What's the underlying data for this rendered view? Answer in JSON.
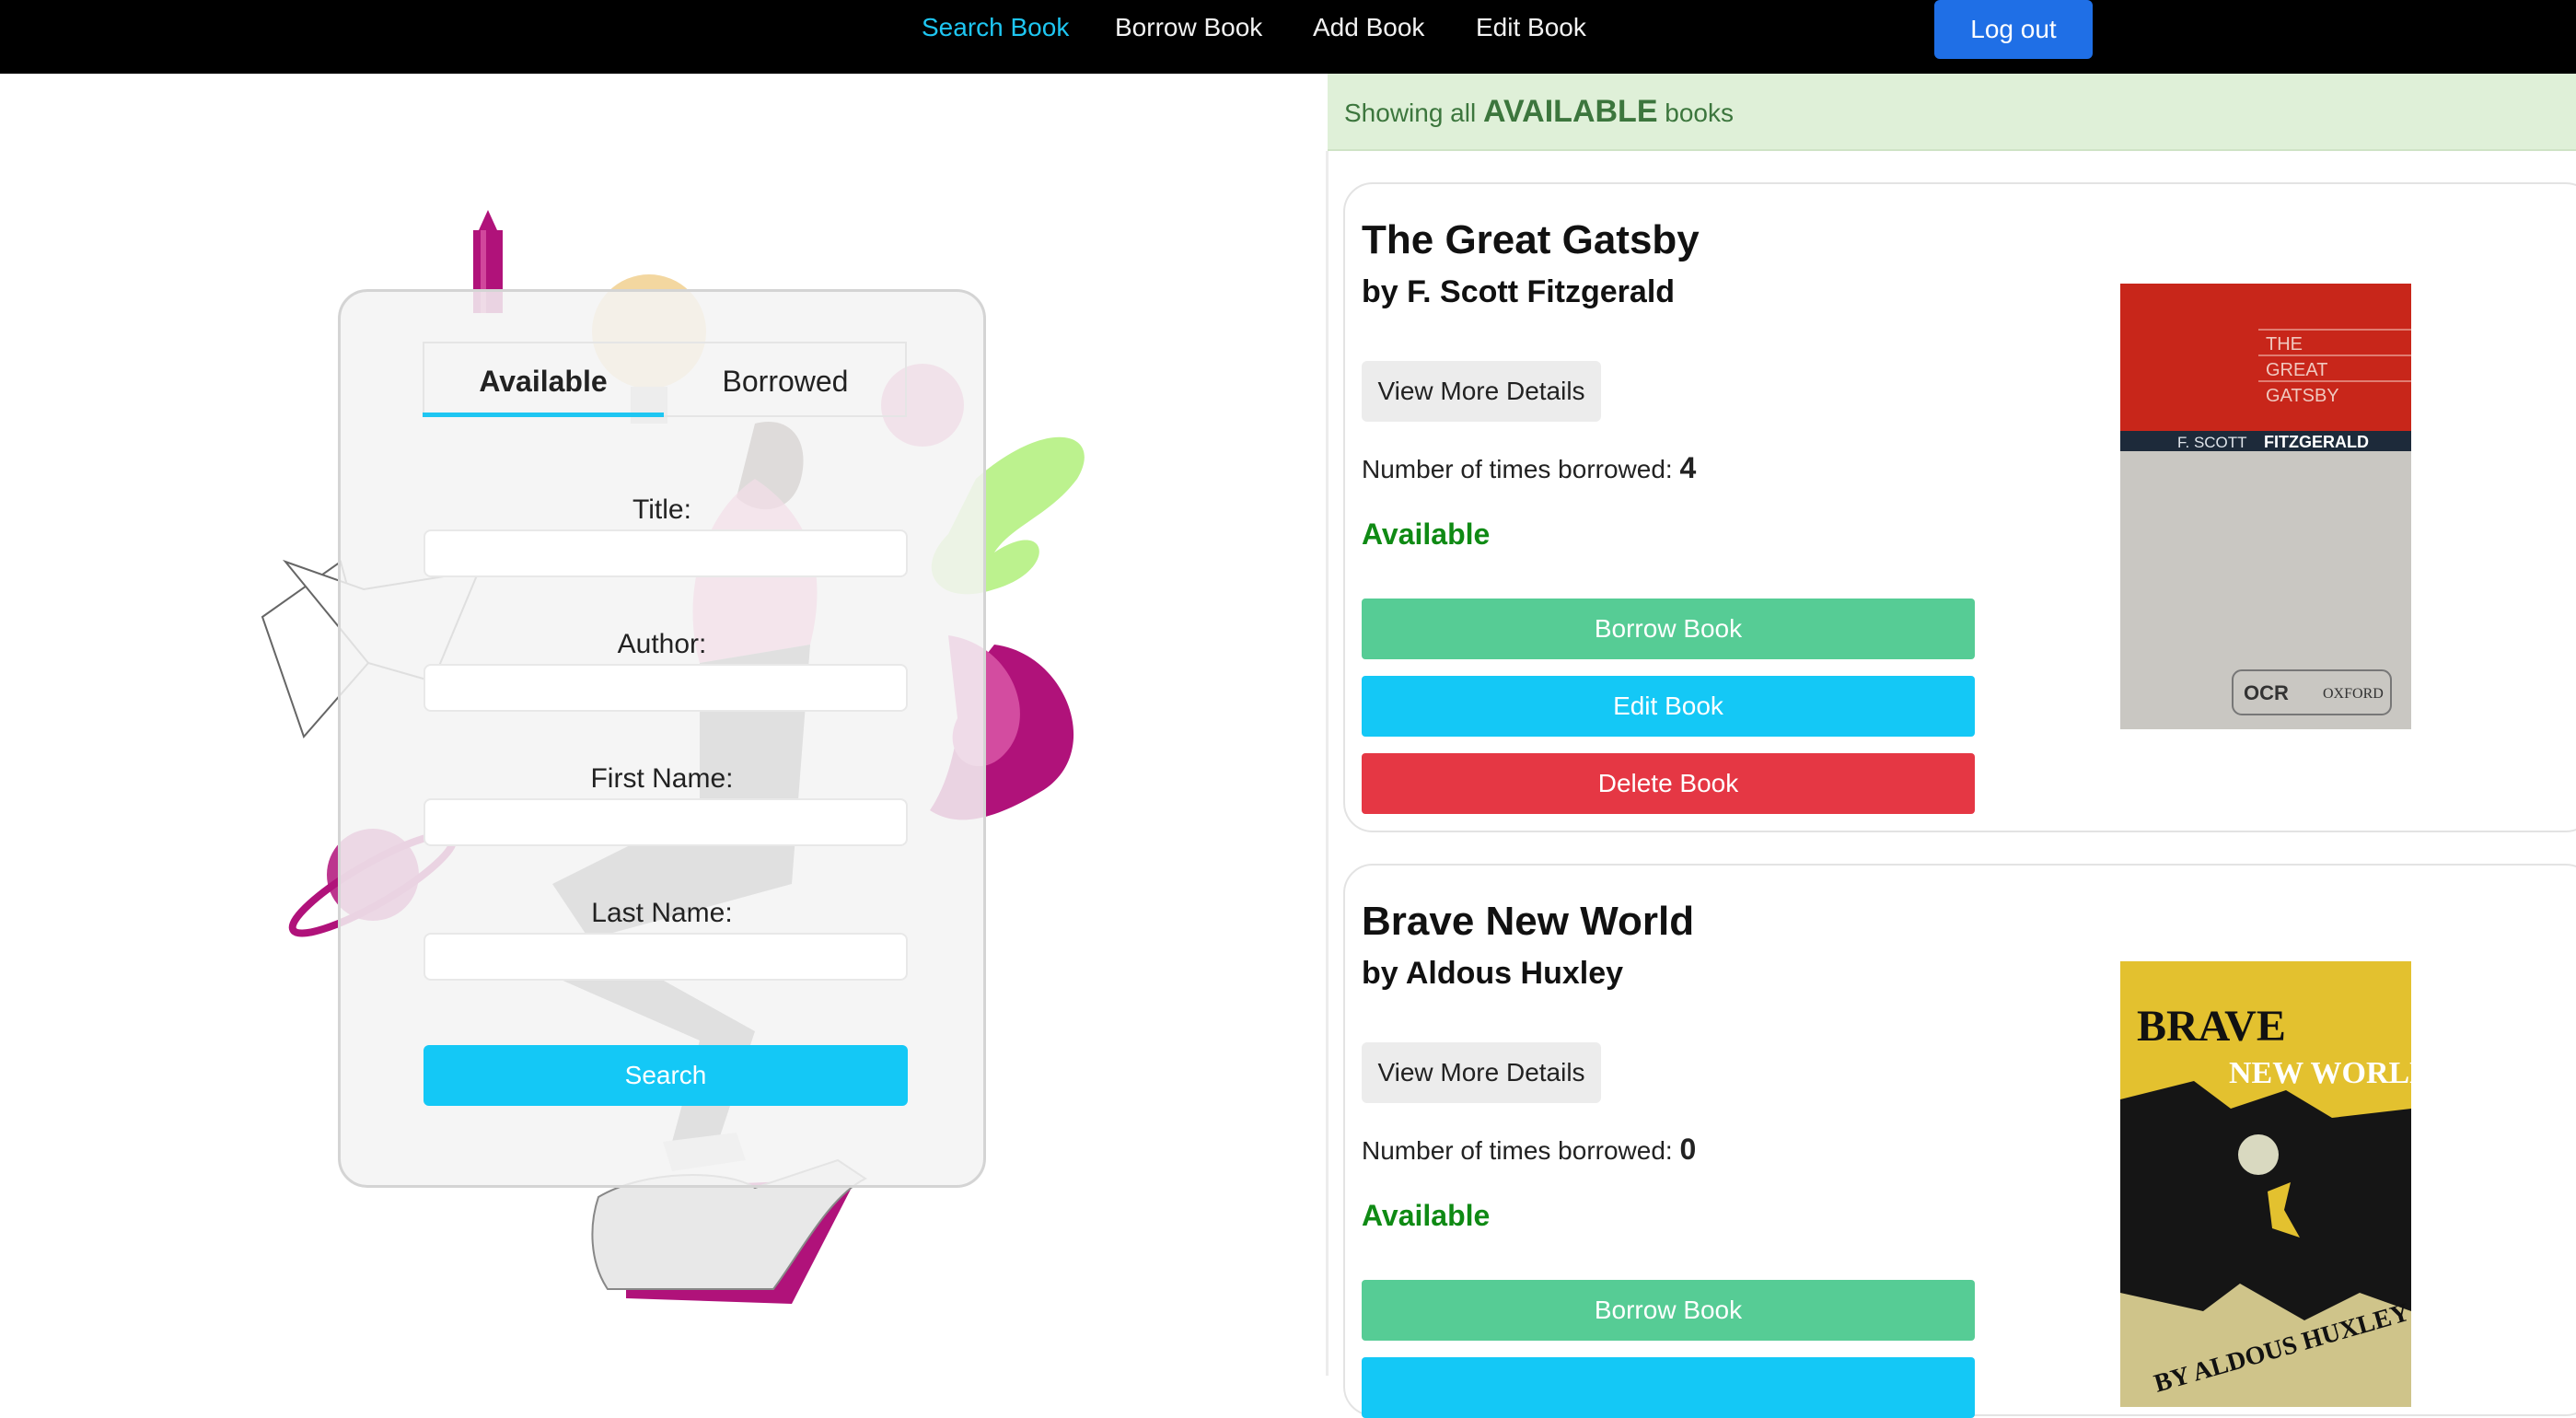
{
  "nav": {
    "links": [
      "Search Book",
      "Borrow Book",
      "Add Book",
      "Edit Book"
    ],
    "active": "Search Book",
    "logout_label": "Log out"
  },
  "search_form": {
    "tabs": [
      "Available",
      "Borrowed"
    ],
    "active_tab": "Available",
    "fields": {
      "title_label": "Title:",
      "author_label": "Author:",
      "first_name_label": "First Name:",
      "last_name_label": "Last Name:",
      "title_value": "",
      "author_value": "",
      "first_name_value": "",
      "last_name_value": ""
    },
    "search_label": "Search"
  },
  "banner": {
    "prefix": "Showing all",
    "emphasis": "AVAILABLE",
    "suffix": "books"
  },
  "books": [
    {
      "title": "The Great Gatsby",
      "author_line": "by F. Scott Fitzgerald",
      "details_label": "View More Details",
      "borrowed_label": "Number of times borrowed:",
      "borrowed_count": "4",
      "status": "Available",
      "borrow_label": "Borrow Book",
      "edit_label": "Edit Book",
      "delete_label": "Delete Book",
      "cover": {
        "title_lines": [
          "THE",
          "GREAT",
          "GATSBY"
        ],
        "author_prefix": "F. SCOTT",
        "author_surname": "FITZGERALD",
        "badge_left": "OCR",
        "badge_right": "OXFORD"
      }
    },
    {
      "title": "Brave New World",
      "author_line": "by Aldous Huxley",
      "details_label": "View More Details",
      "borrowed_label": "Number of times borrowed:",
      "borrowed_count": "0",
      "status": "Available",
      "borrow_label": "Borrow Book",
      "cover": {
        "title_word1": "BRAVE",
        "title_word2": "NEW WORLD",
        "author_line": "BY ALDOUS HUXLEY"
      }
    }
  ],
  "colors": {
    "nav_bg": "#000000",
    "nav_active": "#1ec6f2",
    "logout": "#1f6fe6",
    "borrow": "#56cc95",
    "edit": "#14c8f6",
    "delete": "#e53744",
    "available": "#0f8a14",
    "banner_bg": "#dff0d8"
  }
}
